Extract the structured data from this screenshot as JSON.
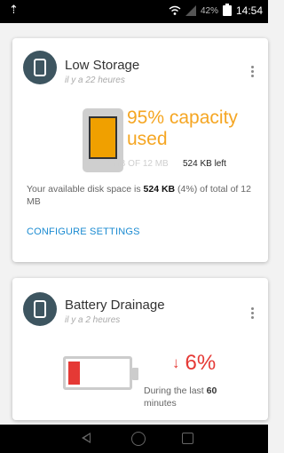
{
  "status_bar": {
    "left_icon": "upload-icon",
    "left_glyph": "⇡",
    "battery_percent": "42%",
    "time": "14:54"
  },
  "card_low_storage": {
    "title": "Low Storage",
    "timestamp": "il y a 22 heures",
    "capacity_text": "95% capacity used",
    "storage_used": "11MB OF 12 MB",
    "storage_left": "524 KB left",
    "desc_prefix": "Your available disk space is ",
    "desc_free": "524 KB",
    "desc_suffix": " (4%) of total of 12 MB",
    "configure_label": "CONFIGURE SETTINGS",
    "fill_level": 0.95
  },
  "card_battery": {
    "title": "Battery Drainage",
    "timestamp": "il y a 2 heures",
    "arrow": "↓",
    "drop_percent": "6%",
    "during_prefix": "During the last ",
    "during_value": "60",
    "during_suffix": " minutes",
    "fill_level": 0.2
  },
  "colors": {
    "accent_orange": "#f5a623",
    "alert_red": "#e53935",
    "link_blue": "#1b8bd1",
    "icon_bg": "#3d5560"
  }
}
